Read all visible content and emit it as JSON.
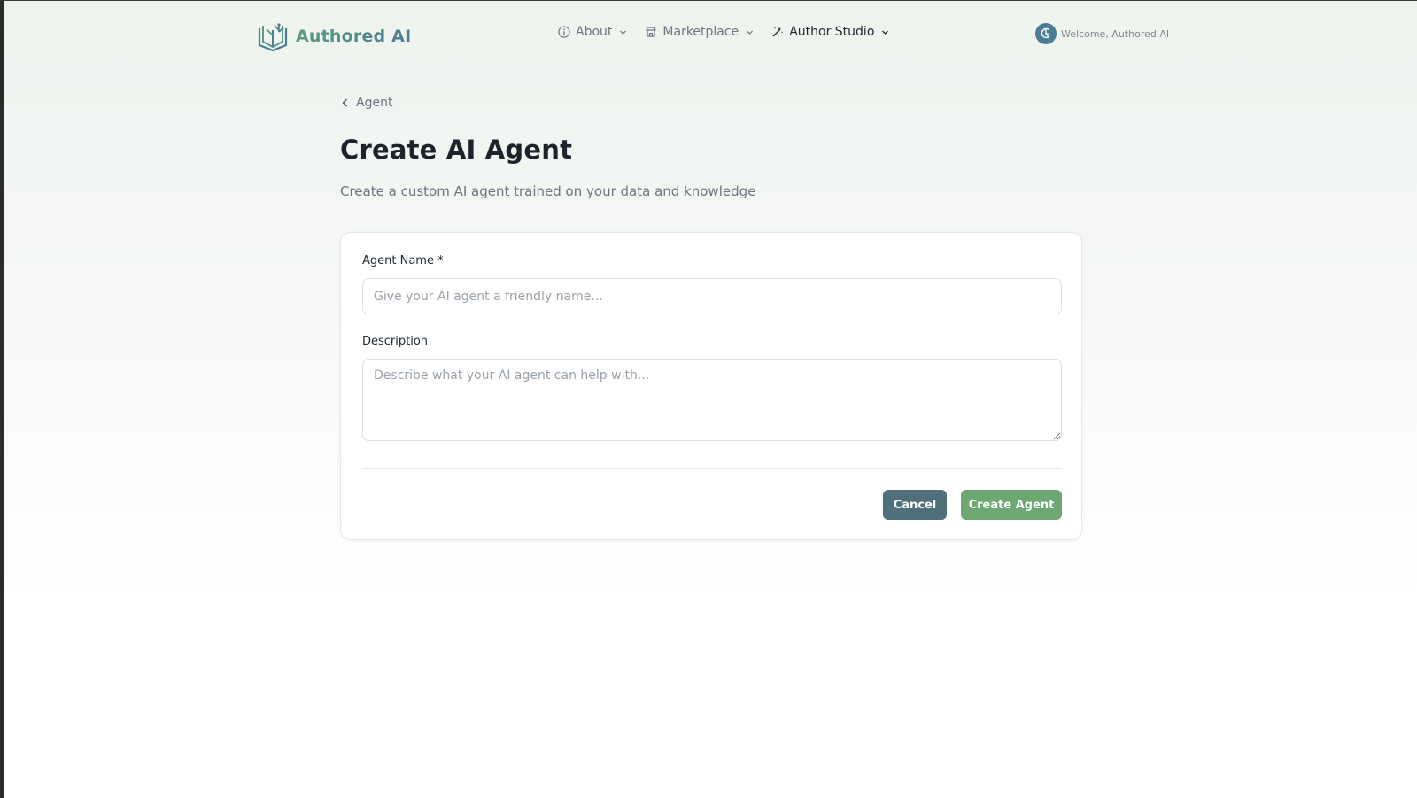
{
  "header": {
    "brand_name": "Authored AI",
    "nav": [
      {
        "label": "About",
        "icon": "info-icon"
      },
      {
        "label": "Marketplace",
        "icon": "store-icon"
      },
      {
        "label": "Author Studio",
        "icon": "wand-icon",
        "active": true
      }
    ],
    "welcome_text": "Welcome, Authored AI"
  },
  "breadcrumb": {
    "back_label": "Agent"
  },
  "page": {
    "title": "Create AI Agent",
    "subtitle": "Create a custom AI agent trained on your data and knowledge"
  },
  "form": {
    "name_label": "Agent Name *",
    "name_placeholder": "Give your AI agent a friendly name...",
    "name_value": "",
    "description_label": "Description",
    "description_placeholder": "Describe what your AI agent can help with...",
    "description_value": "",
    "cancel_label": "Cancel",
    "create_label": "Create Agent"
  },
  "colors": {
    "brand_green": "#5a9a83",
    "brand_blue": "#4a7e96",
    "cancel_button": "#4f6f7a",
    "create_button": "#6da872"
  }
}
